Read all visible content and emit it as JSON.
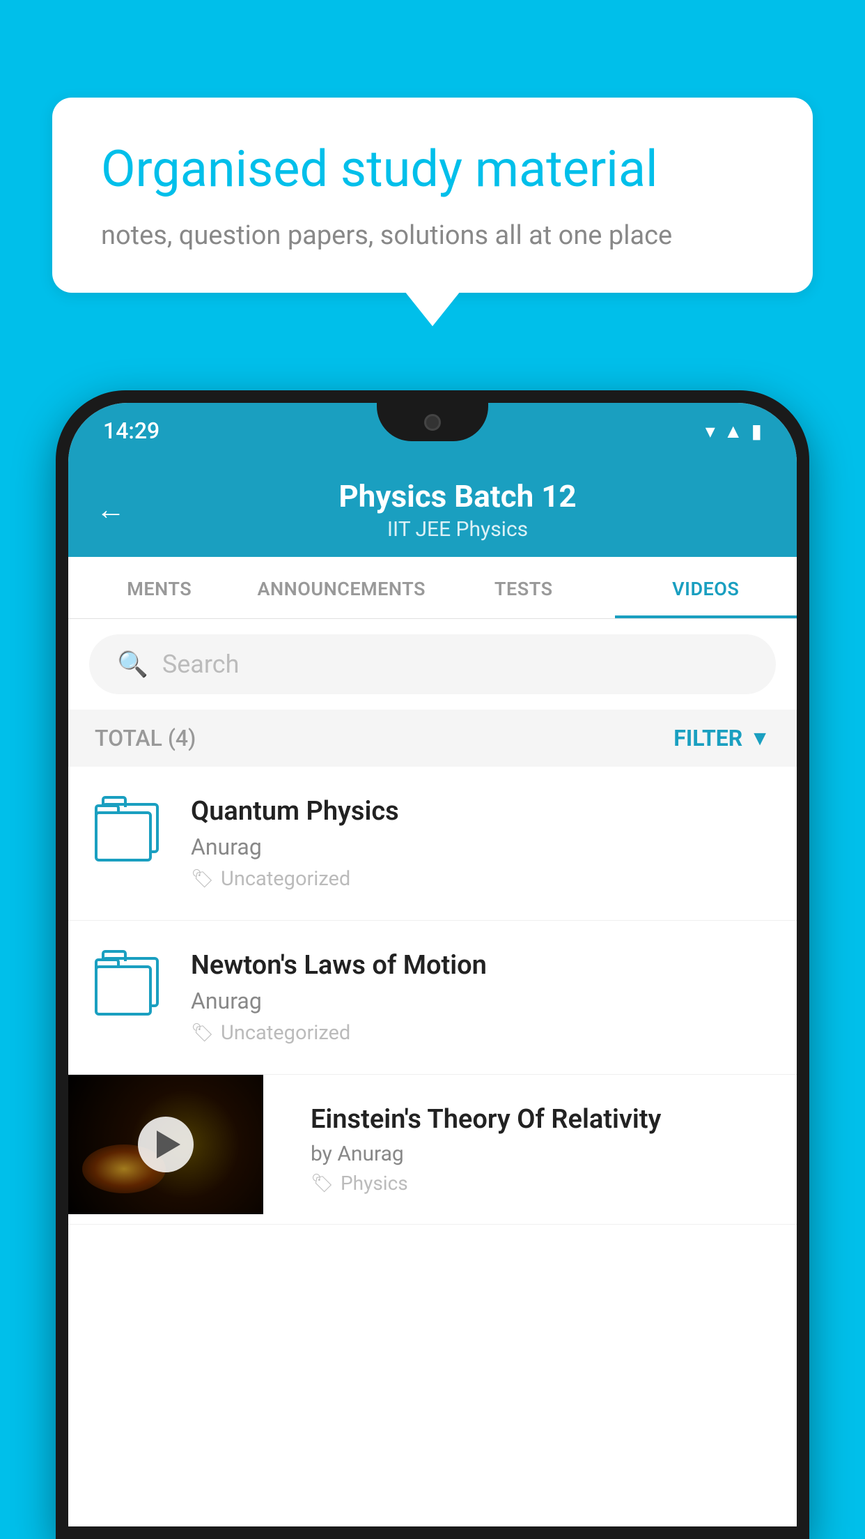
{
  "background_color": "#00BFEA",
  "speech_bubble": {
    "title": "Organised study material",
    "subtitle": "notes, question papers, solutions all at one place"
  },
  "phone": {
    "status_bar": {
      "time": "14:29",
      "icons": [
        "wifi",
        "signal",
        "battery"
      ]
    },
    "header": {
      "title": "Physics Batch 12",
      "subtitle": "IIT JEE   Physics",
      "back_label": "←"
    },
    "tabs": [
      {
        "label": "MENTS",
        "active": false
      },
      {
        "label": "ANNOUNCEMENTS",
        "active": false
      },
      {
        "label": "TESTS",
        "active": false
      },
      {
        "label": "VIDEOS",
        "active": true
      }
    ],
    "search": {
      "placeholder": "Search"
    },
    "filter_bar": {
      "total_label": "TOTAL (4)",
      "filter_label": "FILTER"
    },
    "videos": [
      {
        "id": "quantum",
        "title": "Quantum Physics",
        "author": "Anurag",
        "tag": "Uncategorized",
        "has_thumb": false
      },
      {
        "id": "newton",
        "title": "Newton's Laws of Motion",
        "author": "Anurag",
        "tag": "Uncategorized",
        "has_thumb": false
      },
      {
        "id": "einstein",
        "title": "Einstein's Theory Of Relativity",
        "author": "by Anurag",
        "tag": "Physics",
        "has_thumb": true
      }
    ]
  }
}
